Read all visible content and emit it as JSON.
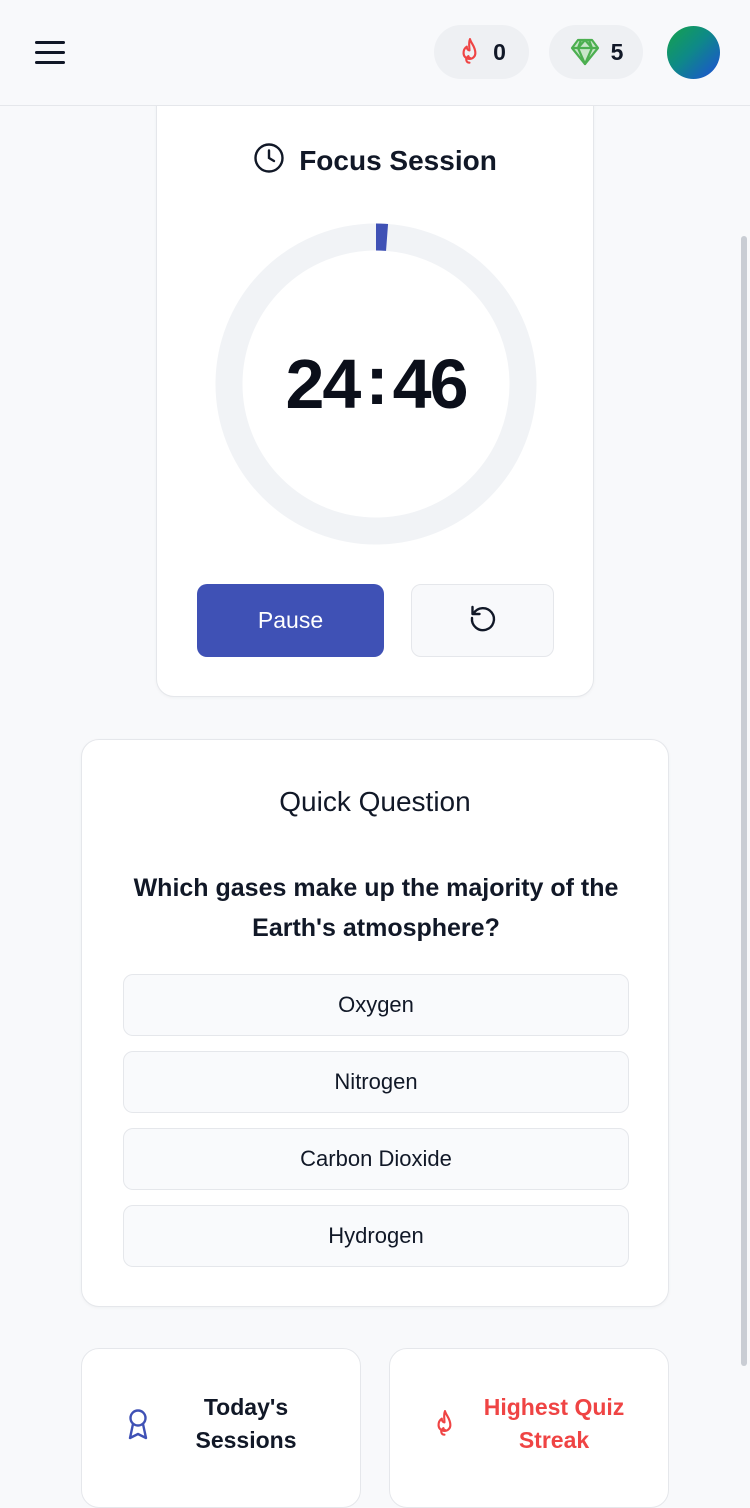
{
  "header": {
    "streak_count": "0",
    "gems_count": "5"
  },
  "focus": {
    "title": "Focus Session",
    "time_minutes": "24",
    "time_separator": ":",
    "time_seconds": "46",
    "progress_fraction": 0.012,
    "pause_label": "Pause"
  },
  "quiz": {
    "title": "Quick Question",
    "question": "Which gases make up the majority of the Earth's atmosphere?",
    "options": [
      "Oxygen",
      "Nitrogen",
      "Carbon Dioxide",
      "Hydrogen"
    ]
  },
  "stats": {
    "sessions_label": "Today's Sessions",
    "streak_label": "Highest Quiz Streak"
  },
  "colors": {
    "primary": "#3f51b5",
    "streak_red": "#ef4444",
    "gem_green": "#4caf50"
  }
}
